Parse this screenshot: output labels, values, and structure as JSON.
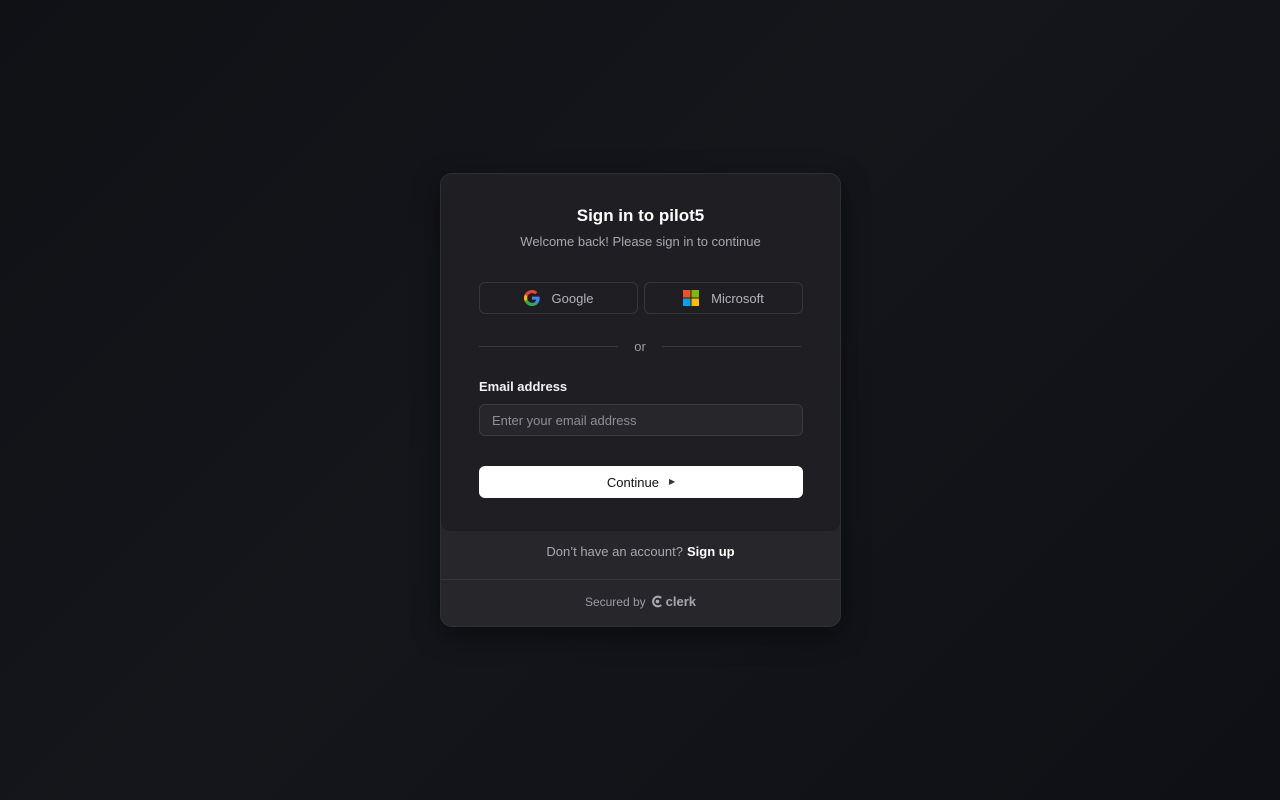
{
  "header": {
    "title": "Sign in to pilot5",
    "subtitle": "Welcome back! Please sign in to continue"
  },
  "social": {
    "google_label": "Google",
    "microsoft_label": "Microsoft"
  },
  "divider": {
    "text": "or"
  },
  "email": {
    "label": "Email address",
    "placeholder": "Enter your email address",
    "value": ""
  },
  "actions": {
    "continue_label": "Continue"
  },
  "footer": {
    "prompt": "Don’t have an account?",
    "signup_label": "Sign up",
    "secured_by": "Secured by",
    "brand": "clerk"
  },
  "icons": {
    "google": "google-icon",
    "microsoft": "microsoft-icon",
    "caret": "caret-right-icon",
    "clerk": "clerk-logo-icon"
  },
  "colors": {
    "background": "#101217",
    "card": "#1f1f23",
    "footer": "#26262b",
    "primary_button": "#ffffff",
    "google_blue": "#4285F4",
    "google_red": "#EA4335",
    "google_yellow": "#FBBC05",
    "google_green": "#34A853",
    "ms_red": "#F25022",
    "ms_green": "#7FBA00",
    "ms_blue": "#00A4EF",
    "ms_yellow": "#FFB900"
  }
}
